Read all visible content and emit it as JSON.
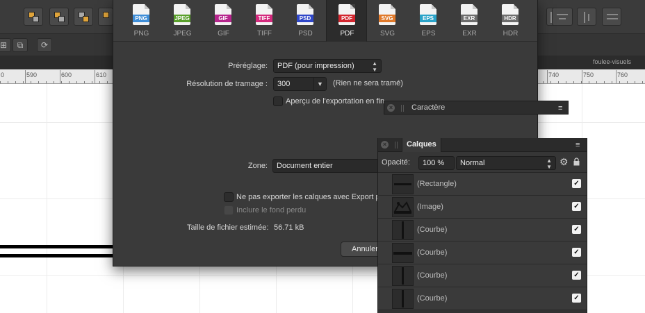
{
  "app": {
    "document_tab": "foulee-visuels",
    "ruler_labels": [
      "0",
      "590",
      "600",
      "610",
      "740",
      "750",
      "760"
    ]
  },
  "export_dialog": {
    "formats": [
      {
        "name": "PNG",
        "band": "PNG",
        "color": "#3f8ed8"
      },
      {
        "name": "JPEG",
        "band": "JPEG",
        "color": "#5aa02c"
      },
      {
        "name": "GIF",
        "band": "GIF",
        "color": "#b6268d"
      },
      {
        "name": "TIFF",
        "band": "TIFF",
        "color": "#d42a7e"
      },
      {
        "name": "PSD",
        "band": "PSD",
        "color": "#2f47c9"
      },
      {
        "name": "PDF",
        "band": "PDF",
        "color": "#d3262f"
      },
      {
        "name": "SVG",
        "band": "SVG",
        "color": "#e0792a"
      },
      {
        "name": "EPS",
        "band": "EPS",
        "color": "#2aa3c9"
      },
      {
        "name": "EXR",
        "band": "EXR",
        "color": "#6d6d6d"
      },
      {
        "name": "HDR",
        "band": "HDR",
        "color": "#6d6d6d"
      }
    ],
    "selected_format": "PDF",
    "preset_label": "Préréglage:",
    "preset_value": "PDF (pour impression)",
    "raster_label": "Résolution de tramage :",
    "raster_value": "300",
    "raster_note": "(Rien ne sera tramé)",
    "preview_label": "Aperçu de l'exportation en fin",
    "area_label": "Zone:",
    "area_value": "Document entier",
    "no_export_layers_label": "Ne pas exporter les calques avec Export p",
    "include_bleed_label": "Inclure le fond perdu",
    "filesize_label": "Taille de fichier estimée:",
    "filesize_value": "56.71 kB",
    "cancel_label": "Annuler"
  },
  "caractere_panel": {
    "title": "Caractère"
  },
  "calques_panel": {
    "title": "Calques",
    "opacity_label": "Opacité:",
    "opacity_value": "100 %",
    "blend_mode": "Normal",
    "layers": [
      {
        "name": "(Rectangle)",
        "visible": true,
        "thumb": "rectangle"
      },
      {
        "name": "(Image)",
        "visible": true,
        "thumb": "image"
      },
      {
        "name": "(Courbe)",
        "visible": true,
        "thumb": "vertical"
      },
      {
        "name": "(Courbe)",
        "visible": true,
        "thumb": "horizontal"
      },
      {
        "name": "(Courbe)",
        "visible": true,
        "thumb": "vertical"
      },
      {
        "name": "(Courbe)",
        "visible": true,
        "thumb": "vertical"
      }
    ]
  }
}
